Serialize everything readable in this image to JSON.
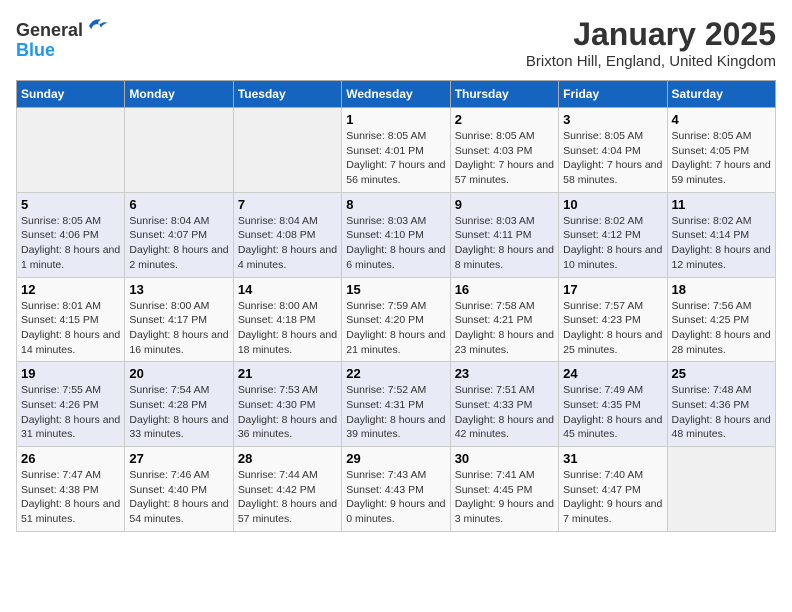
{
  "header": {
    "logo_line1": "General",
    "logo_line2": "Blue",
    "title": "January 2025",
    "subtitle": "Brixton Hill, England, United Kingdom"
  },
  "weekdays": [
    "Sunday",
    "Monday",
    "Tuesday",
    "Wednesday",
    "Thursday",
    "Friday",
    "Saturday"
  ],
  "weeks": [
    [
      {
        "day": "",
        "info": ""
      },
      {
        "day": "",
        "info": ""
      },
      {
        "day": "",
        "info": ""
      },
      {
        "day": "1",
        "info": "Sunrise: 8:05 AM\nSunset: 4:01 PM\nDaylight: 7 hours and 56 minutes."
      },
      {
        "day": "2",
        "info": "Sunrise: 8:05 AM\nSunset: 4:03 PM\nDaylight: 7 hours and 57 minutes."
      },
      {
        "day": "3",
        "info": "Sunrise: 8:05 AM\nSunset: 4:04 PM\nDaylight: 7 hours and 58 minutes."
      },
      {
        "day": "4",
        "info": "Sunrise: 8:05 AM\nSunset: 4:05 PM\nDaylight: 7 hours and 59 minutes."
      }
    ],
    [
      {
        "day": "5",
        "info": "Sunrise: 8:05 AM\nSunset: 4:06 PM\nDaylight: 8 hours and 1 minute."
      },
      {
        "day": "6",
        "info": "Sunrise: 8:04 AM\nSunset: 4:07 PM\nDaylight: 8 hours and 2 minutes."
      },
      {
        "day": "7",
        "info": "Sunrise: 8:04 AM\nSunset: 4:08 PM\nDaylight: 8 hours and 4 minutes."
      },
      {
        "day": "8",
        "info": "Sunrise: 8:03 AM\nSunset: 4:10 PM\nDaylight: 8 hours and 6 minutes."
      },
      {
        "day": "9",
        "info": "Sunrise: 8:03 AM\nSunset: 4:11 PM\nDaylight: 8 hours and 8 minutes."
      },
      {
        "day": "10",
        "info": "Sunrise: 8:02 AM\nSunset: 4:12 PM\nDaylight: 8 hours and 10 minutes."
      },
      {
        "day": "11",
        "info": "Sunrise: 8:02 AM\nSunset: 4:14 PM\nDaylight: 8 hours and 12 minutes."
      }
    ],
    [
      {
        "day": "12",
        "info": "Sunrise: 8:01 AM\nSunset: 4:15 PM\nDaylight: 8 hours and 14 minutes."
      },
      {
        "day": "13",
        "info": "Sunrise: 8:00 AM\nSunset: 4:17 PM\nDaylight: 8 hours and 16 minutes."
      },
      {
        "day": "14",
        "info": "Sunrise: 8:00 AM\nSunset: 4:18 PM\nDaylight: 8 hours and 18 minutes."
      },
      {
        "day": "15",
        "info": "Sunrise: 7:59 AM\nSunset: 4:20 PM\nDaylight: 8 hours and 21 minutes."
      },
      {
        "day": "16",
        "info": "Sunrise: 7:58 AM\nSunset: 4:21 PM\nDaylight: 8 hours and 23 minutes."
      },
      {
        "day": "17",
        "info": "Sunrise: 7:57 AM\nSunset: 4:23 PM\nDaylight: 8 hours and 25 minutes."
      },
      {
        "day": "18",
        "info": "Sunrise: 7:56 AM\nSunset: 4:25 PM\nDaylight: 8 hours and 28 minutes."
      }
    ],
    [
      {
        "day": "19",
        "info": "Sunrise: 7:55 AM\nSunset: 4:26 PM\nDaylight: 8 hours and 31 minutes."
      },
      {
        "day": "20",
        "info": "Sunrise: 7:54 AM\nSunset: 4:28 PM\nDaylight: 8 hours and 33 minutes."
      },
      {
        "day": "21",
        "info": "Sunrise: 7:53 AM\nSunset: 4:30 PM\nDaylight: 8 hours and 36 minutes."
      },
      {
        "day": "22",
        "info": "Sunrise: 7:52 AM\nSunset: 4:31 PM\nDaylight: 8 hours and 39 minutes."
      },
      {
        "day": "23",
        "info": "Sunrise: 7:51 AM\nSunset: 4:33 PM\nDaylight: 8 hours and 42 minutes."
      },
      {
        "day": "24",
        "info": "Sunrise: 7:49 AM\nSunset: 4:35 PM\nDaylight: 8 hours and 45 minutes."
      },
      {
        "day": "25",
        "info": "Sunrise: 7:48 AM\nSunset: 4:36 PM\nDaylight: 8 hours and 48 minutes."
      }
    ],
    [
      {
        "day": "26",
        "info": "Sunrise: 7:47 AM\nSunset: 4:38 PM\nDaylight: 8 hours and 51 minutes."
      },
      {
        "day": "27",
        "info": "Sunrise: 7:46 AM\nSunset: 4:40 PM\nDaylight: 8 hours and 54 minutes."
      },
      {
        "day": "28",
        "info": "Sunrise: 7:44 AM\nSunset: 4:42 PM\nDaylight: 8 hours and 57 minutes."
      },
      {
        "day": "29",
        "info": "Sunrise: 7:43 AM\nSunset: 4:43 PM\nDaylight: 9 hours and 0 minutes."
      },
      {
        "day": "30",
        "info": "Sunrise: 7:41 AM\nSunset: 4:45 PM\nDaylight: 9 hours and 3 minutes."
      },
      {
        "day": "31",
        "info": "Sunrise: 7:40 AM\nSunset: 4:47 PM\nDaylight: 9 hours and 7 minutes."
      },
      {
        "day": "",
        "info": ""
      }
    ]
  ]
}
